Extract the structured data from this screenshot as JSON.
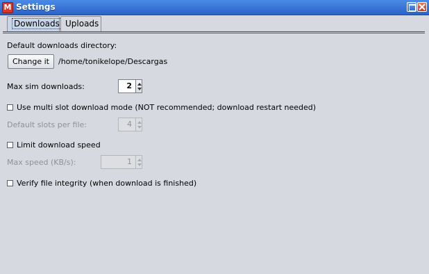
{
  "window": {
    "title": "Settings",
    "app_icon_glyph": "M"
  },
  "tabs": [
    {
      "label": "Downloads",
      "active": true
    },
    {
      "label": "Uploads",
      "active": false
    }
  ],
  "downloads": {
    "directory_label": "Default downloads directory:",
    "change_button": "Change it",
    "directory_path": "/home/tonikelope/Descargas",
    "max_sim_label": "Max sim downloads:",
    "max_sim_value": "2",
    "multislot_label": "Use multi slot download mode (NOT recommended; download restart needed)",
    "multislot_checked": false,
    "slots_label": "Default slots per file:",
    "slots_value": "4",
    "limit_speed_label": "Limit download speed",
    "limit_speed_checked": false,
    "max_speed_label": "Max speed (KB/s):",
    "max_speed_value": "1",
    "verify_label": "Verify file integrity (when download is finished)",
    "verify_checked": false
  },
  "colors": {
    "titlebar": "#2b63c8",
    "background": "#d6d9df",
    "active_tab": "#c9d6ea",
    "tab_line": "#1d5da8"
  },
  "icons": {
    "app": "megabasterd-app-icon",
    "maximize": "maximize-icon",
    "close": "close-icon"
  }
}
